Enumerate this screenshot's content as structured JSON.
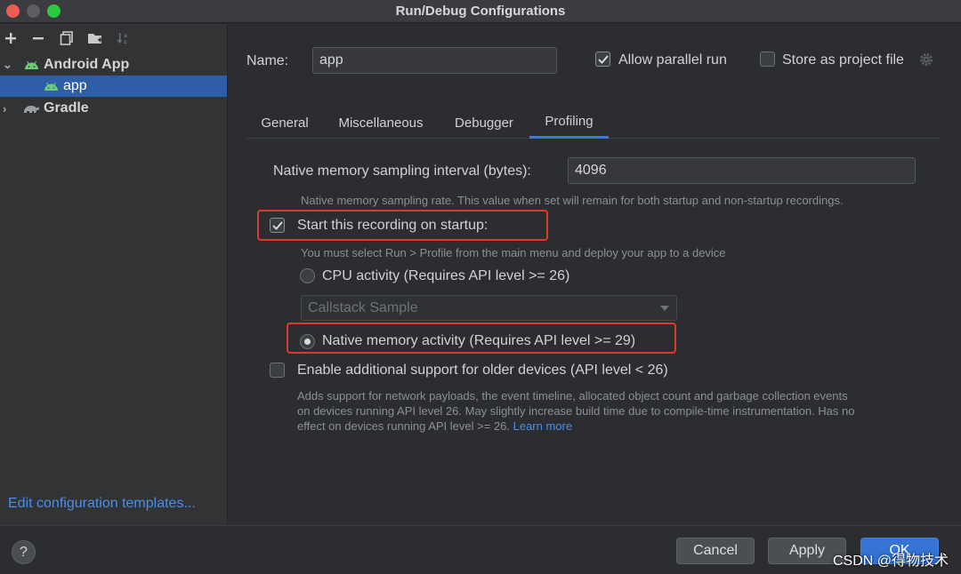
{
  "window": {
    "title": "Run/Debug Configurations"
  },
  "sidebar": {
    "toolbar": [
      {
        "name": "add",
        "icon": "plus-icon"
      },
      {
        "name": "remove",
        "icon": "minus-icon"
      },
      {
        "name": "copy",
        "icon": "copy-icon"
      },
      {
        "name": "new-folder",
        "icon": "folder-plus-icon"
      },
      {
        "name": "sort",
        "icon": "sort-icon"
      }
    ],
    "tree": [
      {
        "label": "Android App",
        "icon": "android-icon",
        "expanded": true
      },
      {
        "label": "app",
        "icon": "android-icon",
        "selected": true
      },
      {
        "label": "Gradle",
        "icon": "gradle-icon",
        "expanded": false
      }
    ],
    "edit_templates": "Edit configuration templates..."
  },
  "header": {
    "name_label": "Name:",
    "name_value": "app",
    "allow_parallel": {
      "label": "Allow parallel run",
      "checked": true
    },
    "store_project": {
      "label": "Store as project file",
      "checked": false
    }
  },
  "tabs": [
    "General",
    "Miscellaneous",
    "Debugger",
    "Profiling"
  ],
  "active_tab": "Profiling",
  "profiling": {
    "interval_label": "Native memory sampling interval (bytes):",
    "interval_value": "4096",
    "interval_hint": "Native memory sampling rate. This value when set will remain for both startup and non-startup recordings.",
    "startup": {
      "label": "Start this recording on startup:",
      "checked": true
    },
    "startup_hint": "You must select Run > Profile from the main menu and deploy your app to a device",
    "cpu": {
      "label": "CPU activity (Requires API level >= 26)",
      "selected": false
    },
    "cpu_combo": "Callstack Sample",
    "native": {
      "label": "Native memory activity (Requires API level >= 29)",
      "selected": true
    },
    "older": {
      "label": "Enable additional support for older devices (API level < 26)",
      "checked": false
    },
    "older_hint_1": "Adds support for network payloads, the event timeline, allocated object count and garbage collection events",
    "older_hint_2": "on devices running API level 26. May slightly increase build time due to compile-time instrumentation. Has no",
    "older_hint_3": "effect on devices running API level >= 26.",
    "learn_more": "Learn more"
  },
  "footer": {
    "help": "?",
    "cancel": "Cancel",
    "apply": "Apply",
    "ok": "OK",
    "watermark": "CSDN @得物技术"
  },
  "colors": {
    "accent": "#3574d4",
    "selection": "#2e5ea8",
    "highlight": "#e0392b",
    "link": "#4c8ee8"
  }
}
